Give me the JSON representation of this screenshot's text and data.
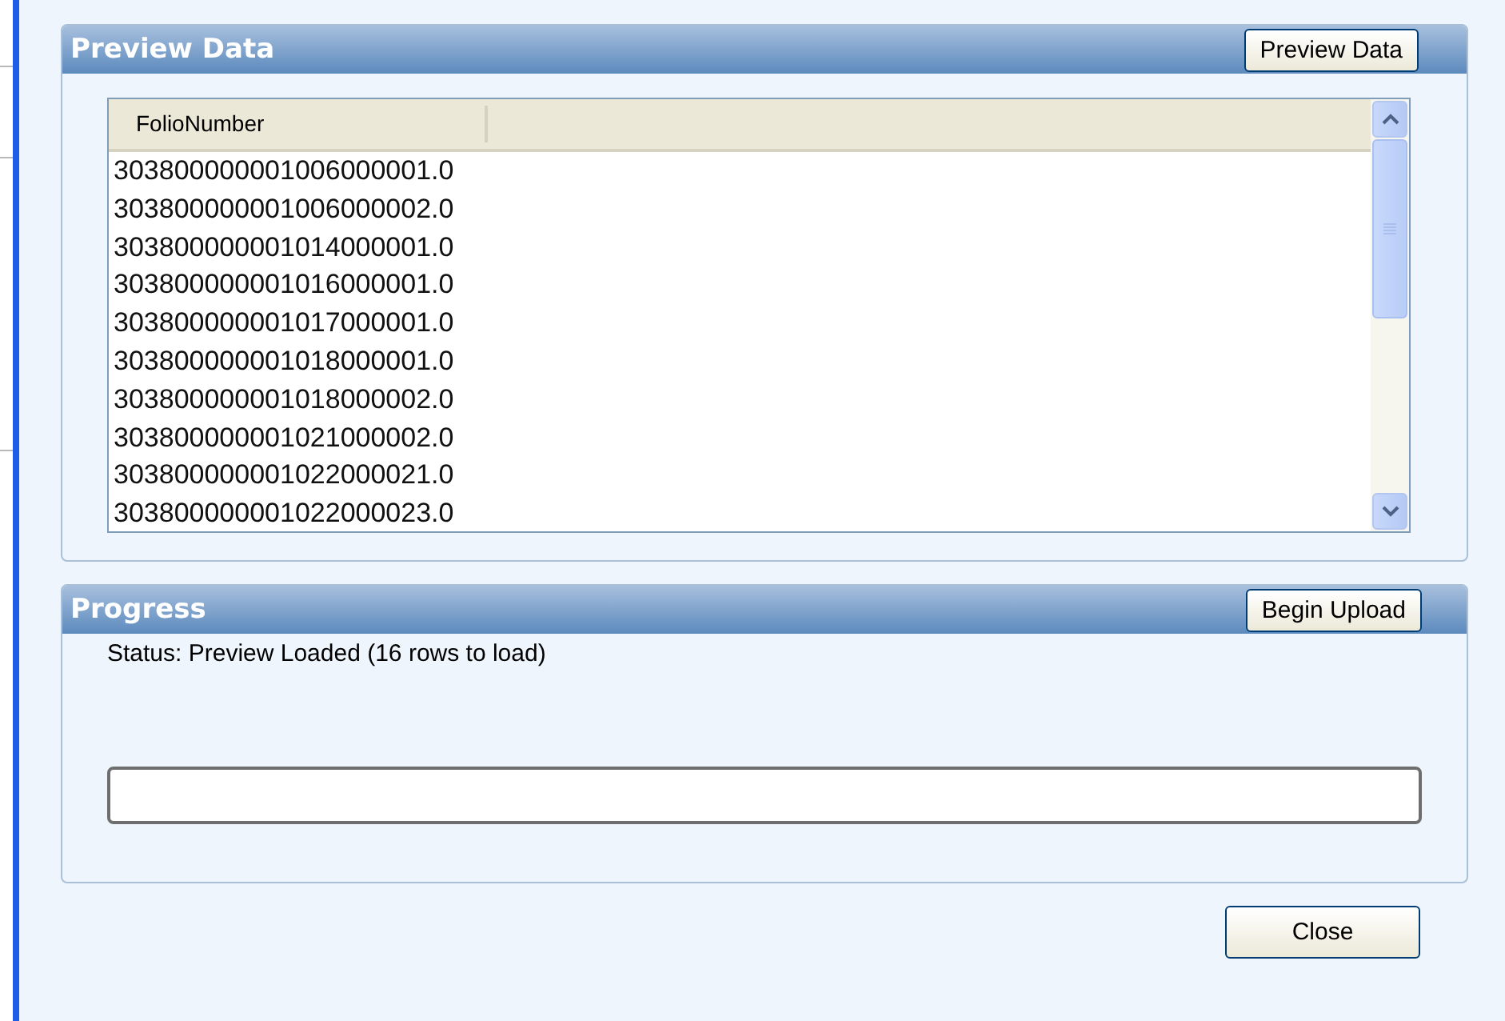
{
  "preview": {
    "title": "Preview Data",
    "button": "Preview Data",
    "table": {
      "columns": [
        "FolioNumber"
      ],
      "rows": [
        "303800000001006000001.0",
        "303800000001006000002.0",
        "303800000001014000001.0",
        "303800000001016000001.0",
        "303800000001017000001.0",
        "303800000001018000001.0",
        "303800000001018000002.0",
        "303800000001021000002.0",
        "303800000001022000021.0",
        "303800000001022000023.0"
      ]
    }
  },
  "progress": {
    "title": "Progress",
    "button": "Begin Upload",
    "status": "Status: Preview Loaded (16 rows to load)",
    "level": 0
  },
  "buttons": [
    "Close"
  ]
}
